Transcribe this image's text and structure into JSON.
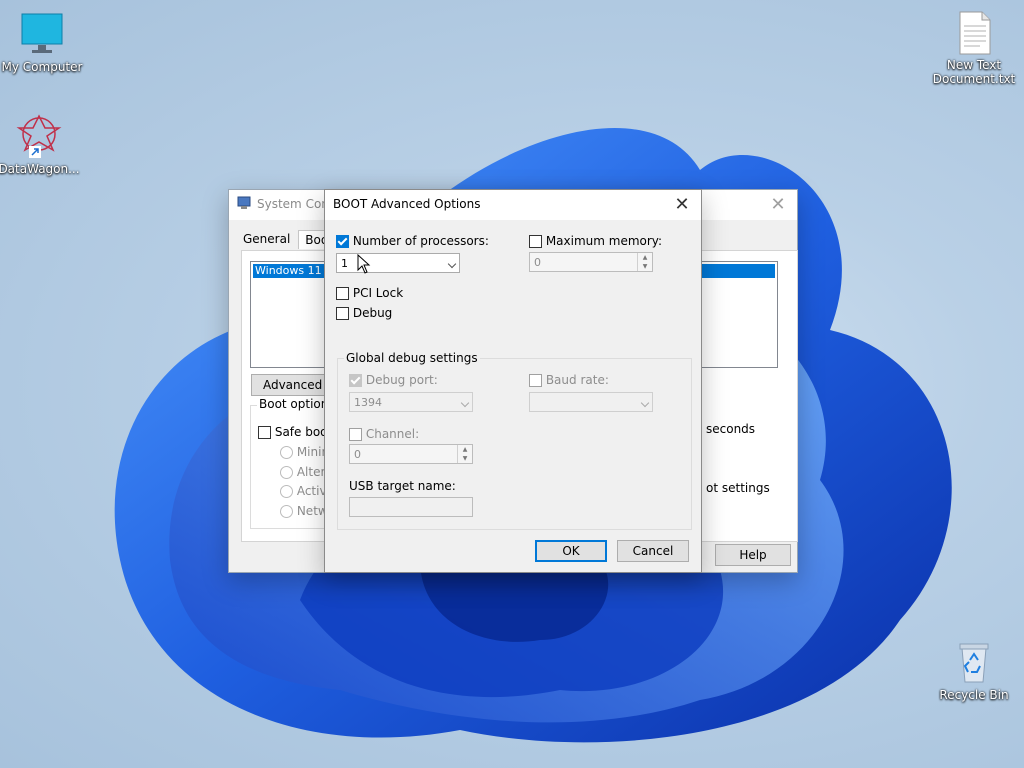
{
  "desktop": {
    "icons": [
      {
        "label": "My Computer",
        "icon": "monitor-icon"
      },
      {
        "label": "DataWagon...",
        "icon": "datawagon-shortcut-icon"
      },
      {
        "label": "New Text\nDocument.txt",
        "icon": "text-document-icon"
      },
      {
        "label": "Recycle Bin",
        "icon": "recycle-bin-icon"
      }
    ]
  },
  "system_config": {
    "title": "System Conf",
    "tabs": [
      "General",
      "Boot"
    ],
    "os_entry": "Windows 11 (C",
    "advanced_button": "Advanced op",
    "boot_options_title": "Boot options",
    "safe_boot_label": "Safe boo",
    "radio_minimal": "Minima",
    "radio_alternate": "Altern",
    "radio_active": "Active",
    "radio_network": "Netwo",
    "seconds_label": "seconds",
    "boot_settings_label": "ot settings",
    "help_button": "Help"
  },
  "boot_advanced": {
    "title": "BOOT Advanced Options",
    "number_of_processors": {
      "label": "Number of processors:",
      "checked": true,
      "value": "1"
    },
    "maximum_memory": {
      "label": "Maximum memory:",
      "checked": false,
      "value": "0"
    },
    "pci_lock": {
      "label": "PCI Lock",
      "checked": false
    },
    "debug": {
      "label": "Debug",
      "checked": false
    },
    "global_debug_settings": {
      "title": "Global debug settings",
      "debug_port": {
        "label": "Debug port:",
        "checked": true,
        "value": "1394"
      },
      "baud_rate": {
        "label": "Baud rate:",
        "checked": false,
        "value": ""
      },
      "channel": {
        "label": "Channel:",
        "checked": false,
        "value": "0"
      },
      "usb_target_name": {
        "label": "USB target name:",
        "value": ""
      }
    },
    "ok_button": "OK",
    "cancel_button": "Cancel"
  },
  "colors": {
    "accent": "#0078d7",
    "wallpaper_blue": "#1f5fe0"
  }
}
